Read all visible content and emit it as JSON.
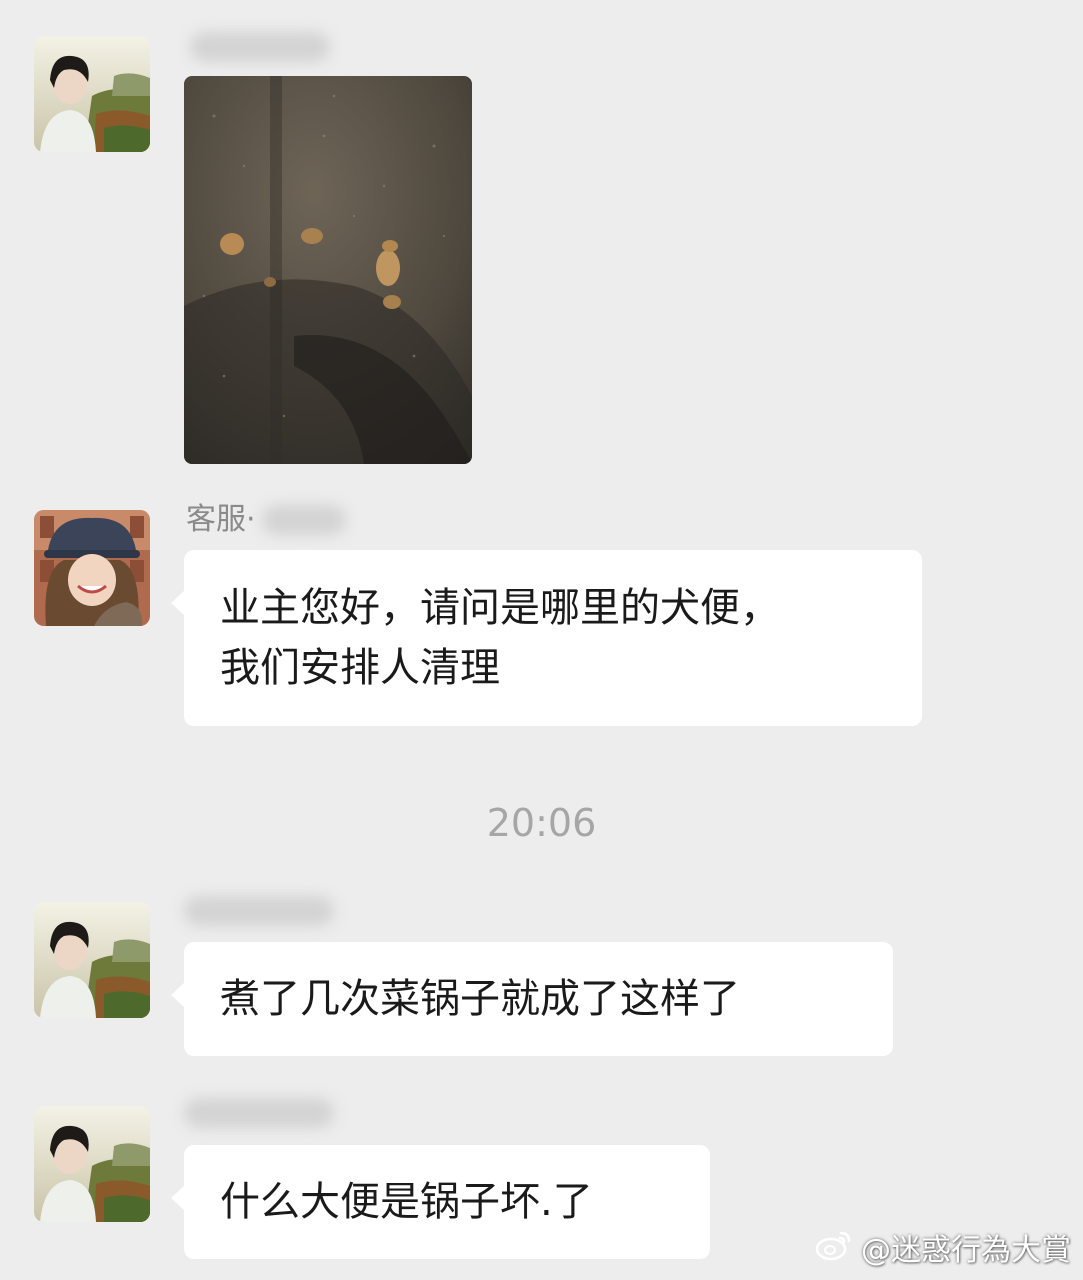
{
  "messages": [
    {
      "type": "image",
      "avatar": "owner-avatar-icon"
    },
    {
      "type": "text",
      "sender_name": "客服·",
      "avatar": "agent-avatar-icon",
      "text": "业主您好，请问是哪里的犬便，\n我们安排人清理"
    },
    {
      "type": "text",
      "avatar": "owner-avatar-icon",
      "text": "煮了几次菜锅子就成了这样了"
    },
    {
      "type": "text",
      "avatar": "owner-avatar-icon",
      "text": "什么大便是锅子坏.了"
    }
  ],
  "timestamp": "20:06",
  "watermark": {
    "text": "@迷惑行為大賞",
    "icon": "weibo-icon"
  },
  "colors": {
    "background": "#ededed",
    "bubble": "#ffffff",
    "timestamp": "#a6a6a6",
    "name": "#8a8a8a"
  }
}
